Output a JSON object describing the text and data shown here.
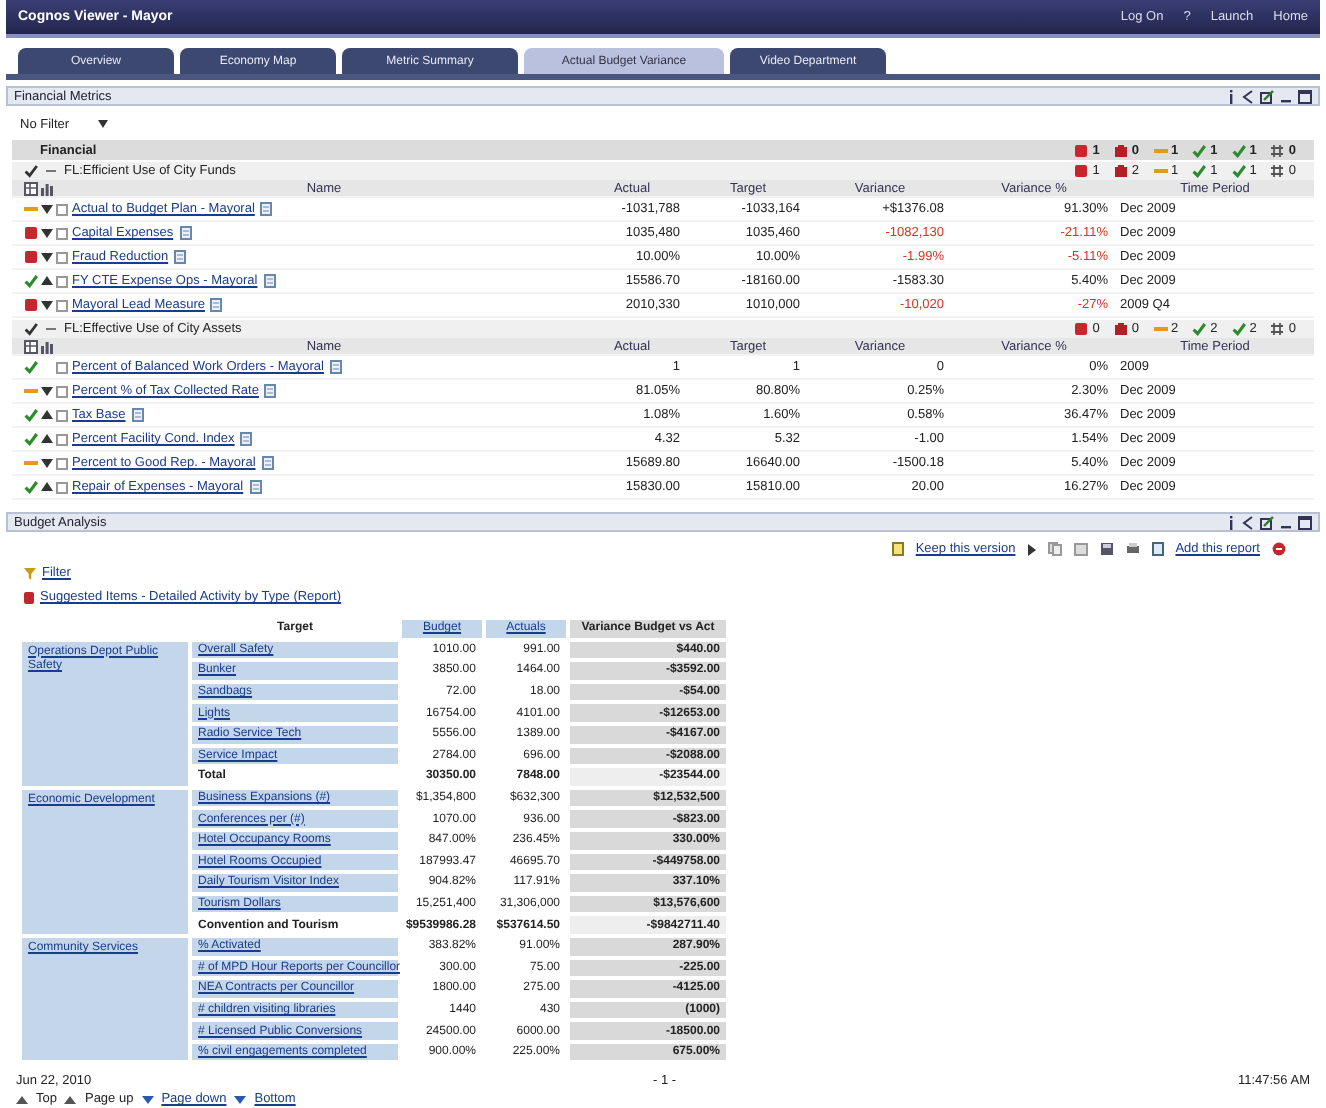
{
  "header": {
    "title": "Cognos Viewer - Mayor",
    "links": [
      "Log On",
      "?",
      "Launch",
      "Home"
    ]
  },
  "tabs": [
    {
      "label": "Overview",
      "selected": false
    },
    {
      "label": "Economy Map",
      "selected": false
    },
    {
      "label": "Metric Summary",
      "selected": false
    },
    {
      "label": "Actual Budget Variance",
      "selected": true
    },
    {
      "label": "Video Department",
      "selected": false
    }
  ],
  "financial_metrics": {
    "title": "Financial Metrics",
    "filter": "No Filter",
    "scorecard": {
      "name": "Financial",
      "counts": [
        {
          "kind": "bad",
          "count": "1"
        },
        {
          "kind": "stop",
          "count": "0"
        },
        {
          "kind": "warn",
          "count": "1"
        },
        {
          "kind": "ok",
          "count": "1"
        },
        {
          "kind": "ok",
          "count": "1"
        },
        {
          "kind": "flat",
          "count": "0"
        }
      ],
      "groups": [
        {
          "name": "FL:Efficient Use of City Funds",
          "counts": [
            {
              "kind": "bad",
              "count": "1"
            },
            {
              "kind": "stop",
              "count": "2"
            },
            {
              "kind": "warn",
              "count": "1"
            },
            {
              "kind": "ok",
              "count": "1"
            },
            {
              "kind": "ok",
              "count": "1"
            },
            {
              "kind": "flat",
              "count": "0"
            }
          ],
          "columns": [
            "Name",
            "Actual",
            "Target",
            "Variance",
            "Variance %",
            "Time Period"
          ],
          "metrics": [
            {
              "kind": "warn",
              "trend_up": false,
              "name": "Actual to Budget Plan - Mayoral",
              "actual": "-1031,788",
              "target": "-1033,164",
              "variance": "+$1376.08",
              "variance_pct": "91.30%",
              "period": "Dec 2009",
              "negative": false
            },
            {
              "kind": "bad",
              "trend_up": false,
              "name": "Capital Expenses",
              "actual": "1035,480",
              "target": "1035,460",
              "variance": "-1082,130",
              "variance_pct": "-21.11%",
              "period": "Dec 2009",
              "negative": true
            },
            {
              "kind": "bad",
              "trend_up": false,
              "name": "Fraud Reduction",
              "actual": "10.00%",
              "target": "10.00%",
              "variance": "-1.99%",
              "variance_pct": "-5.11%",
              "period": "Dec 2009",
              "negative": true
            },
            {
              "kind": "ok",
              "trend_up": true,
              "name": "FY CTE Expense Ops - Mayoral",
              "actual": "15586.70",
              "target": "-18160.00",
              "variance": "-1583.30",
              "variance_pct": "5.40%",
              "period": "Dec 2009",
              "negative": false
            },
            {
              "kind": "bad",
              "trend_up": false,
              "name": "Mayoral Lead Measure",
              "actual": "2010,330",
              "target": "1010,000",
              "variance": "-10,020",
              "variance_pct": "-27%",
              "period": "2009 Q4",
              "negative": true
            }
          ]
        },
        {
          "name": "FL:Effective Use of City Assets",
          "counts": [
            {
              "kind": "bad",
              "count": "0"
            },
            {
              "kind": "stop",
              "count": "0"
            },
            {
              "kind": "warn",
              "count": "2"
            },
            {
              "kind": "ok",
              "count": "2"
            },
            {
              "kind": "ok",
              "count": "2"
            },
            {
              "kind": "flat",
              "count": "0"
            }
          ],
          "columns": [
            "Name",
            "Actual",
            "Target",
            "Variance",
            "Variance %",
            "Time Period"
          ],
          "metrics": [
            {
              "kind": "ok",
              "name": "Percent of Balanced Work Orders - Mayoral",
              "actual": "1",
              "target": "1",
              "variance": "0",
              "variance_pct": "0%",
              "period": "2009",
              "negative": false
            },
            {
              "kind": "warn",
              "trend_up": false,
              "name": "Percent % of Tax Collected Rate",
              "actual": "81.05%",
              "target": "80.80%",
              "variance": "0.25%",
              "variance_pct": "2.30%",
              "period": "Dec 2009",
              "negative": false
            },
            {
              "kind": "ok",
              "trend_up": true,
              "name": "Tax Base",
              "actual": "1.08%",
              "target": "1.60%",
              "variance": "0.58%",
              "variance_pct": "36.47%",
              "period": "Dec 2009",
              "negative": false
            },
            {
              "kind": "ok",
              "trend_up": true,
              "name": "Percent Facility Cond. Index",
              "actual": "4.32",
              "target": "5.32",
              "variance": "-1.00",
              "variance_pct": "1.54%",
              "period": "Dec 2009",
              "negative": false
            },
            {
              "kind": "warn",
              "trend_up": false,
              "name": "Percent to Good Rep. - Mayoral",
              "actual": "15689.80",
              "target": "16640.00",
              "variance": "-1500.18",
              "variance_pct": "5.40%",
              "period": "Dec 2009",
              "negative": false
            },
            {
              "kind": "ok",
              "trend_up": true,
              "name": "Repair of Expenses - Mayoral",
              "actual": "15830.00",
              "target": "15810.00",
              "variance": "20.00",
              "variance_pct": "16.27%",
              "period": "Dec 2009",
              "negative": false
            }
          ]
        }
      ]
    }
  },
  "budget_analysis": {
    "title": "Budget Analysis",
    "keep_link": "Keep this version",
    "add_link": "Add this report",
    "filter_link": "Filter",
    "report_link": "Suggested Items - Detailed Activity by Type (Report)",
    "crosstab": {
      "columns": [
        "Target",
        "Budget",
        "Actuals",
        "Variance Budget vs Act"
      ],
      "groups": [
        {
          "name": "Operations Depot Public Safety",
          "rows": [
            {
              "label": "Overall Safety",
              "budget": "1010.00",
              "actuals": "991.00",
              "variance": "$440.00",
              "total": false
            },
            {
              "label": "Bunker",
              "budget": "3850.00",
              "actuals": "1464.00",
              "variance": "-$3592.00",
              "total": false
            },
            {
              "label": "Sandbags",
              "budget": "72.00",
              "actuals": "18.00",
              "variance": "-$54.00",
              "total": false
            },
            {
              "label": "Lights",
              "budget": "16754.00",
              "actuals": "4101.00",
              "variance": "-$12653.00",
              "total": false
            },
            {
              "label": "Radio Service Tech",
              "budget": "5556.00",
              "actuals": "1389.00",
              "variance": "-$4167.00",
              "total": false
            },
            {
              "label": "Service Impact",
              "budget": "2784.00",
              "actuals": "696.00",
              "variance": "-$2088.00",
              "total": false
            },
            {
              "label": "Total",
              "budget": "30350.00",
              "actuals": "7848.00",
              "variance": "-$23544.00",
              "total": true
            }
          ]
        },
        {
          "name": "Economic Development",
          "rows": [
            {
              "label": "Business Expansions (#)",
              "budget": "$1,354,800",
              "actuals": "$632,300",
              "variance": "$12,532,500",
              "total": false
            },
            {
              "label": "Conferences per (#)",
              "budget": "1070.00",
              "actuals": "936.00",
              "variance": "-$823.00",
              "total": false
            },
            {
              "label": "Hotel Occupancy Rooms",
              "budget": "847.00%",
              "actuals": "236.45%",
              "variance": "330.00%",
              "total": false
            },
            {
              "label": "Hotel Rooms Occupied",
              "budget": "187993.47",
              "actuals": "46695.70",
              "variance": "-$449758.00",
              "total": false
            },
            {
              "label": "Daily Tourism Visitor Index",
              "budget": "904.82%",
              "actuals": "117.91%",
              "variance": "337.10%",
              "total": false
            },
            {
              "label": "Tourism Dollars",
              "budget": "15,251,400",
              "actuals": "31,306,000",
              "variance": "$13,576,600",
              "total": false
            },
            {
              "label": "Convention and Tourism",
              "budget": "$9539986.28",
              "actuals": "$537614.50",
              "variance": "-$9842711.40",
              "total": true
            }
          ]
        },
        {
          "name": "Community Services",
          "rows": [
            {
              "label": "% Activated",
              "budget": "383.82%",
              "actuals": "91.00%",
              "variance": "287.90%",
              "total": false
            },
            {
              "label": "# of MPD Hour Reports per Councillor",
              "budget": "300.00",
              "actuals": "75.00",
              "variance": "-225.00",
              "total": false
            },
            {
              "label": "NEA Contracts per Councillor",
              "budget": "1800.00",
              "actuals": "275.00",
              "variance": "-4125.00",
              "total": false
            },
            {
              "label": "# children visiting libraries",
              "budget": "1440",
              "actuals": "430",
              "variance": "(1000)",
              "total": false
            },
            {
              "label": "# Licensed Public Conversions",
              "budget": "24500.00",
              "actuals": "6000.00",
              "variance": "-18500.00",
              "total": false
            },
            {
              "label": "% civil engagements completed",
              "budget": "900.00%",
              "actuals": "225.00%",
              "variance": "675.00%",
              "total": false
            }
          ]
        }
      ]
    },
    "footer": {
      "date": "Jun 22, 2010",
      "page": "- 1 -",
      "time": "11:47:56 AM",
      "nav": [
        "Top",
        "Page up",
        "Page down",
        "Bottom"
      ]
    }
  }
}
